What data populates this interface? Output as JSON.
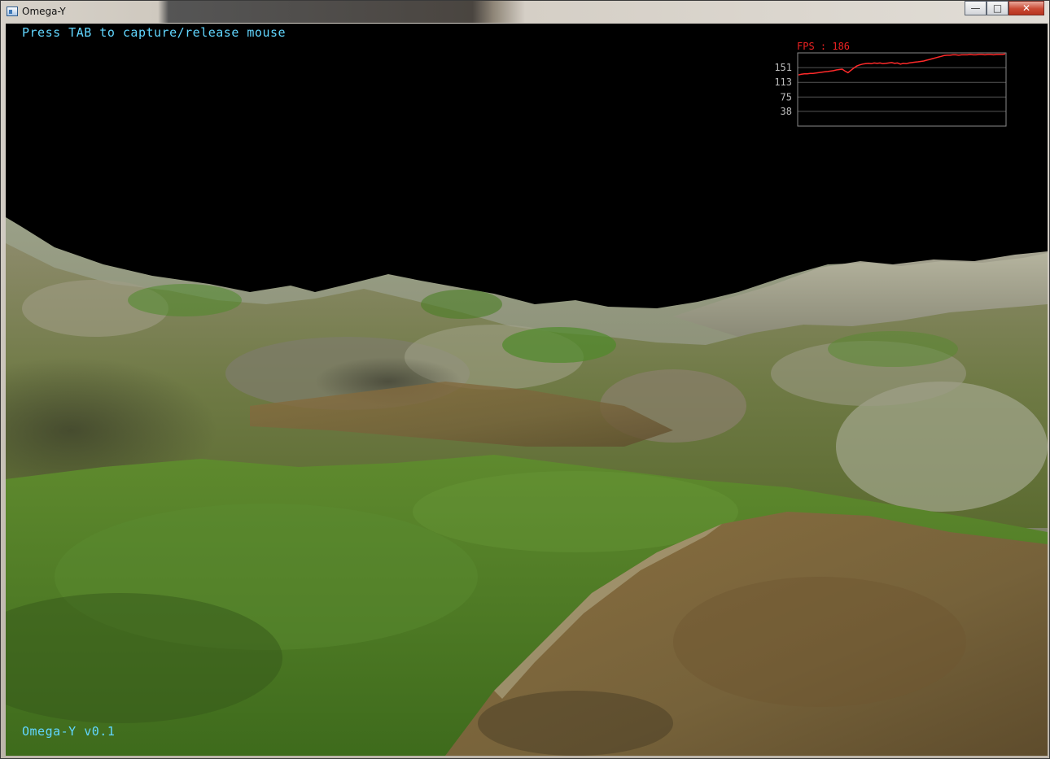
{
  "window": {
    "title": "Omega-Y",
    "minimize_glyph": "—",
    "maximize_glyph": "□",
    "close_glyph": "✕"
  },
  "hud": {
    "hint": "Press TAB to capture/release mouse",
    "version": "Omega-Y v0.1",
    "fps_label": "FPS : 186"
  },
  "chart_data": {
    "type": "line",
    "title": "FPS : 186",
    "xlabel": "",
    "ylabel": "",
    "y_ticks": [
      151,
      113,
      75,
      38
    ],
    "ylim": [
      0,
      189
    ],
    "grid": true,
    "series": [
      {
        "color": "#ff2a2a",
        "values": [
          132,
          134,
          135,
          135,
          136,
          136,
          137,
          138,
          139,
          140,
          141,
          142,
          143,
          145,
          146,
          147,
          142,
          138,
          144,
          150,
          155,
          158,
          160,
          161,
          162,
          161,
          163,
          162,
          163,
          161,
          162,
          163,
          164,
          162,
          163,
          160,
          162,
          161,
          163,
          164,
          165,
          166,
          167,
          168,
          170,
          172,
          174,
          176,
          178,
          180,
          182,
          183,
          183,
          184,
          184,
          183,
          184,
          184,
          184,
          185,
          184,
          184,
          185,
          185,
          184,
          185,
          185,
          184,
          185,
          185,
          185,
          186
        ]
      }
    ]
  },
  "colors": {
    "hud_text": "#61d6ff",
    "fps_line": "#ff2a2a",
    "graph_frame": "#8a8a8a",
    "sky": "#000000"
  }
}
